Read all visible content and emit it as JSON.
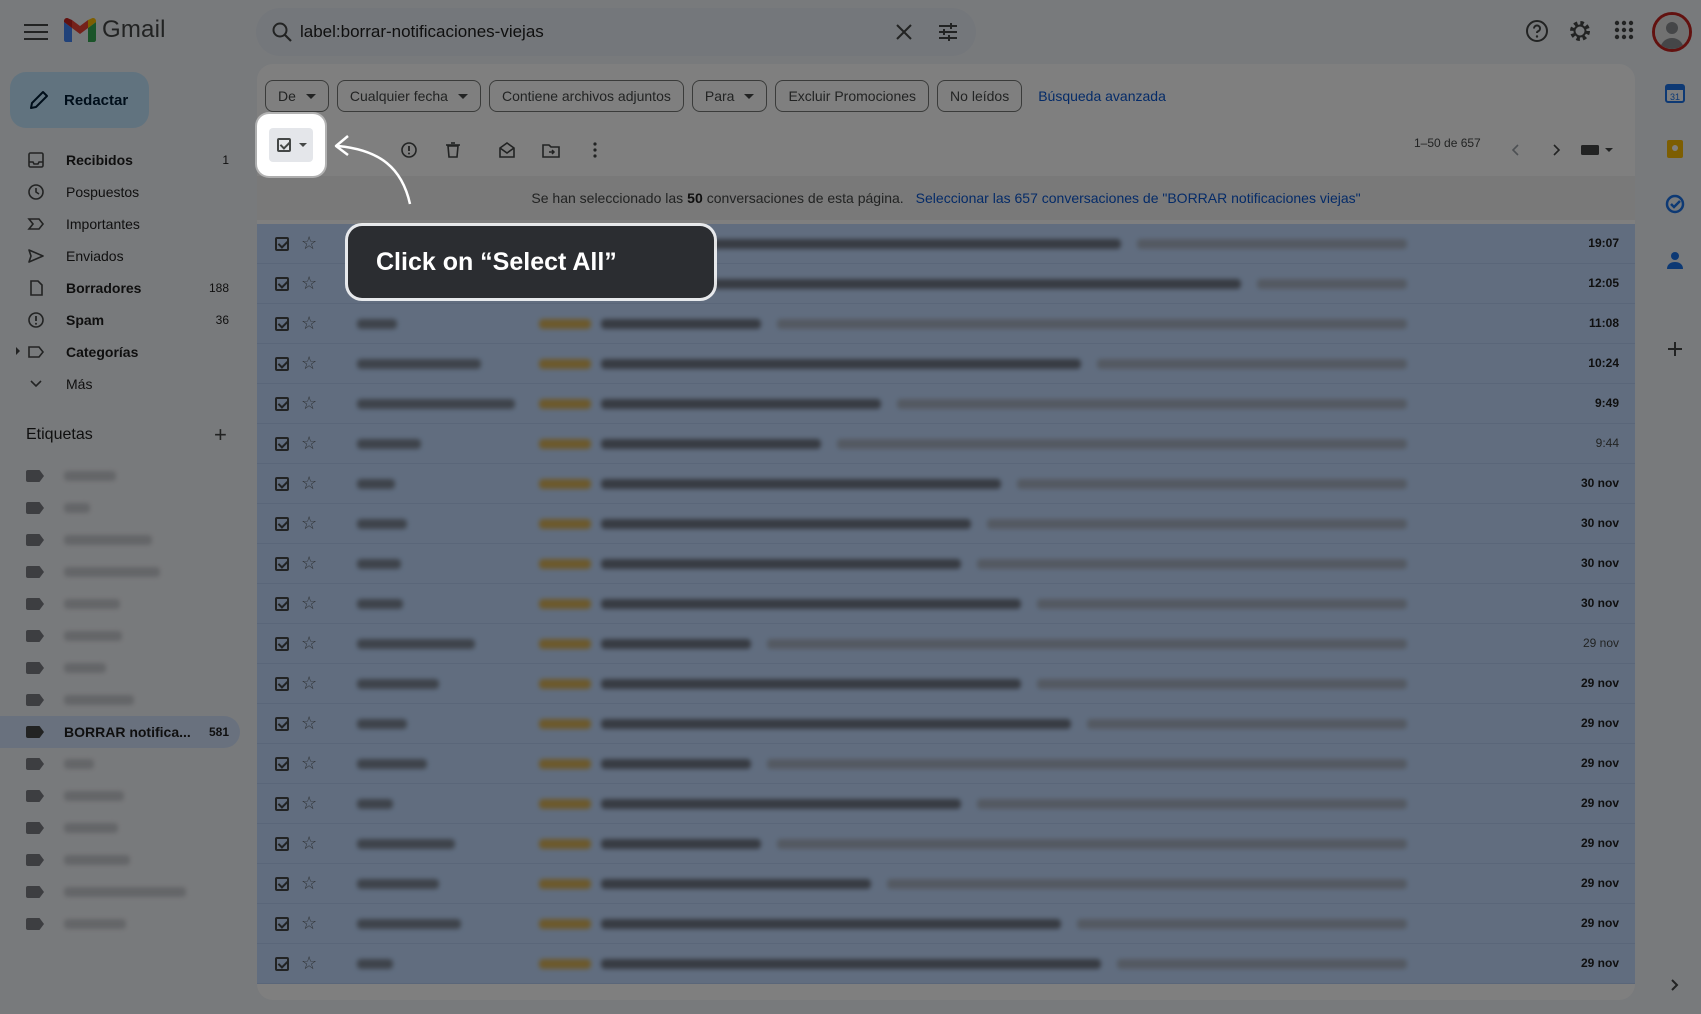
{
  "header": {
    "app_name": "Gmail",
    "search_query": "label:borrar-notificaciones-viejas"
  },
  "sidebar": {
    "compose_label": "Redactar",
    "items": [
      {
        "label": "Recibidos",
        "count": "1",
        "bold": true,
        "icon": "inbox-icon"
      },
      {
        "label": "Pospuestos",
        "count": "",
        "bold": false,
        "icon": "clock-icon"
      },
      {
        "label": "Importantes",
        "count": "",
        "bold": false,
        "icon": "important-icon"
      },
      {
        "label": "Enviados",
        "count": "",
        "bold": false,
        "icon": "send-icon"
      },
      {
        "label": "Borradores",
        "count": "188",
        "bold": true,
        "icon": "draft-icon"
      },
      {
        "label": "Spam",
        "count": "36",
        "bold": true,
        "icon": "spam-icon"
      },
      {
        "label": "Categorías",
        "count": "",
        "bold": true,
        "icon": "label-icon"
      },
      {
        "label": "Más",
        "count": "",
        "bold": false,
        "icon": "chevron-down-icon"
      }
    ],
    "labels_heading": "Etiquetas",
    "selected_label": {
      "name": "BORRAR notifica...",
      "count": "581"
    }
  },
  "filters": {
    "chips": [
      "De",
      "Cualquier fecha",
      "Contiene archivos adjuntos",
      "Para",
      "Excluir Promociones",
      "No leídos"
    ],
    "advanced_link": "Búsqueda avanzada"
  },
  "toolbar": {
    "pager": "1–50 de 657"
  },
  "banner": {
    "prefix": "Se han seleccionado las",
    "count": "50",
    "suffix": "conversaciones de esta página.",
    "select_all_link": "Seleccionar las 657 conversaciones de \"BORRAR notificaciones viejas\""
  },
  "rows": [
    {
      "time": "19:07",
      "bold": true
    },
    {
      "time": "12:05",
      "bold": true
    },
    {
      "time": "11:08",
      "bold": true
    },
    {
      "time": "10:24",
      "bold": true
    },
    {
      "time": "9:49",
      "bold": true
    },
    {
      "time": "9:44",
      "bold": false
    },
    {
      "time": "30 nov",
      "bold": true
    },
    {
      "time": "30 nov",
      "bold": true
    },
    {
      "time": "30 nov",
      "bold": true
    },
    {
      "time": "30 nov",
      "bold": true
    },
    {
      "time": "29 nov",
      "bold": false
    },
    {
      "time": "29 nov",
      "bold": true
    },
    {
      "time": "29 nov",
      "bold": true
    },
    {
      "time": "29 nov",
      "bold": true
    },
    {
      "time": "29 nov",
      "bold": true
    },
    {
      "time": "29 nov",
      "bold": true
    },
    {
      "time": "29 nov",
      "bold": true
    },
    {
      "time": "29 nov",
      "bold": true
    },
    {
      "time": "29 nov",
      "bold": true
    }
  ],
  "tutorial": {
    "callout_text": "Click on “Select All”"
  },
  "colors": {
    "accent": "#0b57d0",
    "compose_bg": "#c2e7ff",
    "selected_row": "#c2dbff",
    "overlay": "#000000"
  }
}
